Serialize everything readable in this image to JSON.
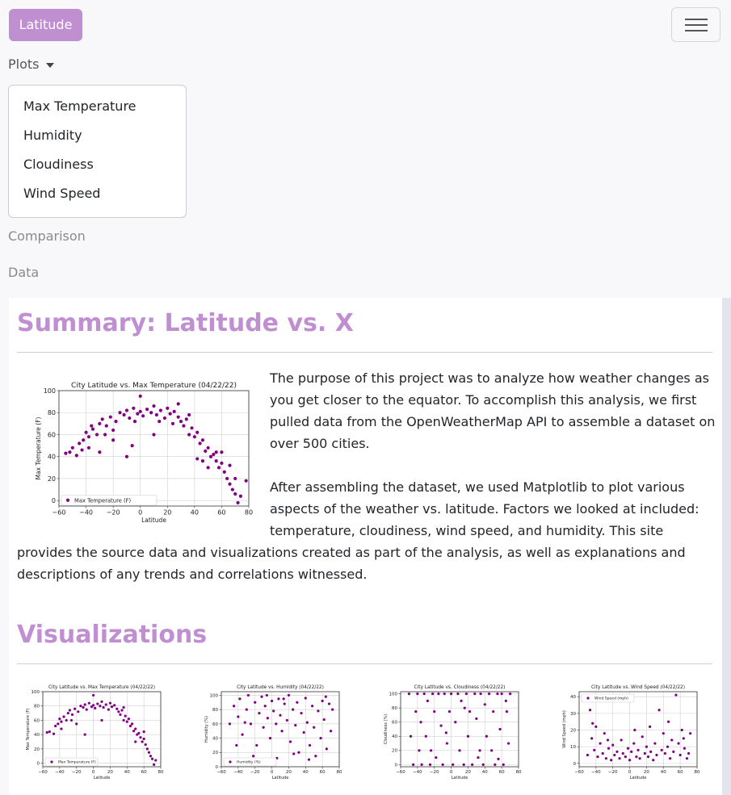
{
  "navbar": {
    "brand": "Latitude",
    "toggler_icon": "hamburger-icon",
    "plots_label": "Plots",
    "plots_menu": [
      "Max Temperature",
      "Humidity",
      "Cloudiness",
      "Wind Speed"
    ],
    "comparison_label": "Comparison",
    "data_label": "Data"
  },
  "colors": {
    "accent": "#c08fd1",
    "marker": "#800080"
  },
  "summary": {
    "heading": "Summary: Latitude vs. X",
    "para1_lines": [
      "The purpose of this project was to analyze how weather changes as",
      "you get closer to the equator. To accomplish this analysis, we first",
      "pulled data from the OpenWeatherMap API to assemble a dataset on",
      "over 500 cities."
    ],
    "para2_lines": [
      "After assembling the dataset, we used Matplotlib to plot various",
      "aspects of the weather vs. latitude. Factors we looked at included:",
      "temperature, cloudiness, wind speed, and humidity. This site",
      "provides the source data and visualizations created as part of the analysis, as well as explanations and",
      "descriptions of any trends and correlations witnessed."
    ]
  },
  "visualizations": {
    "heading": "Visualizations"
  },
  "chart_data": [
    {
      "id": "summary-temp",
      "type": "scatter",
      "title": "City Latitude vs. Max Temperature (04/22/22)",
      "xlabel": "Latitude",
      "ylabel": "Max Temperature (F)",
      "legend": "Max Temperature (F)",
      "xlim": [
        -60,
        80
      ],
      "ylim": [
        -5,
        100
      ],
      "xticks": [
        -60,
        -40,
        -20,
        0,
        20,
        40,
        60,
        80
      ],
      "yticks": [
        0,
        20,
        40,
        60,
        80,
        100
      ],
      "points": [
        [
          -55,
          43
        ],
        [
          -52,
          44
        ],
        [
          -47,
          41
        ],
        [
          -45,
          52
        ],
        [
          -42,
          55
        ],
        [
          -40,
          62
        ],
        [
          -38,
          58
        ],
        [
          -35,
          65
        ],
        [
          -32,
          60
        ],
        [
          -30,
          70
        ],
        [
          -28,
          74
        ],
        [
          -25,
          68
        ],
        [
          -22,
          76
        ],
        [
          -20,
          55
        ],
        [
          -18,
          72
        ],
        [
          -15,
          80
        ],
        [
          -12,
          78
        ],
        [
          -10,
          82
        ],
        [
          -8,
          75
        ],
        [
          -5,
          84
        ],
        [
          -2,
          79
        ],
        [
          0,
          81
        ],
        [
          2,
          77
        ],
        [
          5,
          83
        ],
        [
          8,
          80
        ],
        [
          10,
          86
        ],
        [
          12,
          78
        ],
        [
          15,
          82
        ],
        [
          18,
          75
        ],
        [
          20,
          84
        ],
        [
          22,
          79
        ],
        [
          25,
          81
        ],
        [
          28,
          76
        ],
        [
          30,
          72
        ],
        [
          32,
          68
        ],
        [
          34,
          74
        ],
        [
          36,
          60
        ],
        [
          38,
          66
        ],
        [
          40,
          58
        ],
        [
          42,
          62
        ],
        [
          44,
          52
        ],
        [
          46,
          55
        ],
        [
          48,
          45
        ],
        [
          50,
          48
        ],
        [
          52,
          40
        ],
        [
          54,
          42
        ],
        [
          56,
          36
        ],
        [
          58,
          30
        ],
        [
          60,
          34
        ],
        [
          62,
          26
        ],
        [
          64,
          20
        ],
        [
          66,
          15
        ],
        [
          68,
          10
        ],
        [
          70,
          6
        ],
        [
          72,
          -2
        ],
        [
          -38,
          48
        ],
        [
          -30,
          44
        ],
        [
          -10,
          40
        ],
        [
          -6,
          50
        ],
        [
          10,
          60
        ],
        [
          42,
          38
        ],
        [
          50,
          30
        ],
        [
          -50,
          48
        ],
        [
          -43,
          46
        ],
        [
          -36,
          68
        ],
        [
          -20,
          64
        ],
        [
          0,
          95
        ],
        [
          28,
          88
        ],
        [
          60,
          44
        ],
        [
          66,
          32
        ],
        [
          74,
          4
        ],
        [
          78,
          18
        ],
        [
          70,
          20
        ],
        [
          56,
          44
        ],
        [
          46,
          36
        ],
        [
          36,
          78
        ],
        [
          24,
          70
        ],
        [
          14,
          72
        ],
        [
          -4,
          72
        ],
        [
          -26,
          60
        ]
      ]
    },
    {
      "id": "viz-temp",
      "type": "scatter",
      "title": "City Latitude vs. Max Temperature (04/22/22)",
      "xlabel": "Latitude",
      "ylabel": "Max Temperature (F)",
      "legend": "Max Temperature (F)",
      "xlim": [
        -60,
        80
      ],
      "ylim": [
        -5,
        100
      ],
      "xticks": [
        -60,
        -40,
        -20,
        0,
        20,
        40,
        60,
        80
      ],
      "yticks": [
        0,
        20,
        40,
        60,
        80,
        100
      ],
      "points": [
        [
          -55,
          43
        ],
        [
          -52,
          44
        ],
        [
          -47,
          41
        ],
        [
          -45,
          52
        ],
        [
          -42,
          55
        ],
        [
          -40,
          62
        ],
        [
          -38,
          58
        ],
        [
          -35,
          65
        ],
        [
          -32,
          60
        ],
        [
          -30,
          70
        ],
        [
          -28,
          74
        ],
        [
          -25,
          68
        ],
        [
          -22,
          76
        ],
        [
          -20,
          55
        ],
        [
          -18,
          72
        ],
        [
          -15,
          80
        ],
        [
          -12,
          78
        ],
        [
          -10,
          82
        ],
        [
          -8,
          75
        ],
        [
          -5,
          84
        ],
        [
          -2,
          79
        ],
        [
          0,
          81
        ],
        [
          2,
          77
        ],
        [
          5,
          83
        ],
        [
          8,
          80
        ],
        [
          10,
          86
        ],
        [
          12,
          78
        ],
        [
          15,
          82
        ],
        [
          18,
          75
        ],
        [
          20,
          84
        ],
        [
          22,
          79
        ],
        [
          25,
          81
        ],
        [
          28,
          76
        ],
        [
          30,
          72
        ],
        [
          32,
          68
        ],
        [
          34,
          74
        ],
        [
          36,
          60
        ],
        [
          38,
          66
        ],
        [
          40,
          58
        ],
        [
          42,
          62
        ],
        [
          44,
          52
        ],
        [
          46,
          55
        ],
        [
          48,
          45
        ],
        [
          50,
          48
        ],
        [
          52,
          40
        ],
        [
          54,
          42
        ],
        [
          56,
          36
        ],
        [
          58,
          30
        ],
        [
          60,
          34
        ],
        [
          62,
          26
        ],
        [
          64,
          20
        ],
        [
          66,
          15
        ],
        [
          68,
          10
        ],
        [
          70,
          6
        ],
        [
          72,
          -2
        ],
        [
          -38,
          48
        ],
        [
          -10,
          40
        ],
        [
          10,
          60
        ],
        [
          50,
          30
        ],
        [
          0,
          95
        ],
        [
          60,
          44
        ],
        [
          74,
          4
        ],
        [
          36,
          78
        ],
        [
          -26,
          60
        ]
      ]
    },
    {
      "id": "viz-humidity",
      "type": "scatter",
      "title": "City Latitude vs. Humidity (04/22/22)",
      "xlabel": "Latitude",
      "ylabel": "Humidity (%)",
      "legend": "Humidity (%)",
      "xlim": [
        -60,
        80
      ],
      "ylim": [
        0,
        105
      ],
      "xticks": [
        -60,
        -40,
        -20,
        0,
        20,
        40,
        60,
        80
      ],
      "yticks": [
        0,
        20,
        40,
        60,
        80,
        100
      ],
      "points": [
        [
          -50,
          60
        ],
        [
          -45,
          85
        ],
        [
          -40,
          70
        ],
        [
          -38,
          95
        ],
        [
          -35,
          45
        ],
        [
          -30,
          80
        ],
        [
          -28,
          100
        ],
        [
          -25,
          60
        ],
        [
          -20,
          90
        ],
        [
          -18,
          30
        ],
        [
          -15,
          75
        ],
        [
          -12,
          98
        ],
        [
          -10,
          55
        ],
        [
          -8,
          85
        ],
        [
          -5,
          68
        ],
        [
          -2,
          40
        ],
        [
          0,
          92
        ],
        [
          2,
          78
        ],
        [
          5,
          60
        ],
        [
          8,
          95
        ],
        [
          10,
          72
        ],
        [
          12,
          50
        ],
        [
          15,
          88
        ],
        [
          18,
          65
        ],
        [
          20,
          100
        ],
        [
          22,
          35
        ],
        [
          25,
          80
        ],
        [
          28,
          58
        ],
        [
          30,
          90
        ],
        [
          32,
          20
        ],
        [
          35,
          75
        ],
        [
          38,
          48
        ],
        [
          40,
          96
        ],
        [
          42,
          62
        ],
        [
          45,
          30
        ],
        [
          48,
          85
        ],
        [
          50,
          55
        ],
        [
          52,
          15
        ],
        [
          55,
          78
        ],
        [
          58,
          40
        ],
        [
          60,
          92
        ],
        [
          62,
          66
        ],
        [
          65,
          25
        ],
        [
          68,
          88
        ],
        [
          70,
          50
        ],
        [
          -42,
          30
        ],
        [
          -22,
          15
        ],
        [
          6,
          12
        ],
        [
          26,
          18
        ],
        [
          44,
          10
        ],
        [
          64,
          98
        ],
        [
          72,
          80
        ],
        [
          -32,
          62
        ],
        [
          -6,
          100
        ],
        [
          14,
          95
        ]
      ]
    },
    {
      "id": "viz-cloudiness",
      "type": "scatter",
      "title": "City Latitude vs. Cloudiness (04/22/22)",
      "xlabel": "Latitude",
      "ylabel": "Cloudiness (%)",
      "legend": "",
      "xlim": [
        -60,
        80
      ],
      "ylim": [
        -3,
        103
      ],
      "xticks": [
        -60,
        -40,
        -20,
        0,
        20,
        40,
        60,
        80
      ],
      "yticks": [
        0,
        20,
        40,
        60,
        80,
        100
      ],
      "points": [
        [
          -50,
          100
        ],
        [
          -45,
          0
        ],
        [
          -42,
          75
        ],
        [
          -40,
          100
        ],
        [
          -38,
          20
        ],
        [
          -35,
          0
        ],
        [
          -32,
          100
        ],
        [
          -30,
          40
        ],
        [
          -28,
          90
        ],
        [
          -25,
          0
        ],
        [
          -22,
          100
        ],
        [
          -20,
          75
        ],
        [
          -18,
          10
        ],
        [
          -15,
          100
        ],
        [
          -12,
          55
        ],
        [
          -10,
          0
        ],
        [
          -8,
          100
        ],
        [
          -5,
          30
        ],
        [
          -2,
          75
        ],
        [
          0,
          100
        ],
        [
          2,
          0
        ],
        [
          5,
          60
        ],
        [
          8,
          100
        ],
        [
          10,
          20
        ],
        [
          12,
          90
        ],
        [
          15,
          0
        ],
        [
          18,
          100
        ],
        [
          20,
          40
        ],
        [
          22,
          75
        ],
        [
          25,
          0
        ],
        [
          28,
          100
        ],
        [
          30,
          65
        ],
        [
          32,
          10
        ],
        [
          35,
          100
        ],
        [
          38,
          0
        ],
        [
          40,
          85
        ],
        [
          42,
          40
        ],
        [
          45,
          100
        ],
        [
          48,
          20
        ],
        [
          50,
          75
        ],
        [
          52,
          0
        ],
        [
          55,
          100
        ],
        [
          58,
          50
        ],
        [
          60,
          100
        ],
        [
          62,
          0
        ],
        [
          65,
          90
        ],
        [
          68,
          30
        ],
        [
          70,
          100
        ],
        [
          -48,
          40
        ],
        [
          -36,
          60
        ],
        [
          -6,
          45
        ],
        [
          16,
          80
        ],
        [
          34,
          20
        ],
        [
          56,
          8
        ],
        [
          66,
          75
        ],
        [
          -24,
          20
        ]
      ]
    },
    {
      "id": "viz-wind",
      "type": "scatter",
      "title": "City Latitude vs. Wind Speed (04/22/22)",
      "xlabel": "Latitude",
      "ylabel": "Wind Speed (mph)",
      "legend": "Wind Speed (mph)",
      "xlim": [
        -60,
        80
      ],
      "ylim": [
        -2,
        43
      ],
      "xticks": [
        -60,
        -40,
        -20,
        0,
        20,
        40,
        60,
        80
      ],
      "yticks": [
        0,
        10,
        20,
        30,
        40
      ],
      "points": [
        [
          -50,
          5
        ],
        [
          -47,
          32
        ],
        [
          -45,
          15
        ],
        [
          -42,
          8
        ],
        [
          -40,
          22
        ],
        [
          -38,
          4
        ],
        [
          -35,
          12
        ],
        [
          -32,
          6
        ],
        [
          -30,
          18
        ],
        [
          -28,
          3
        ],
        [
          -25,
          9
        ],
        [
          -22,
          2
        ],
        [
          -20,
          11
        ],
        [
          -18,
          5
        ],
        [
          -15,
          7
        ],
        [
          -12,
          3
        ],
        [
          -10,
          14
        ],
        [
          -8,
          6
        ],
        [
          -5,
          4
        ],
        [
          -2,
          9
        ],
        [
          0,
          2
        ],
        [
          2,
          7
        ],
        [
          5,
          12
        ],
        [
          8,
          4
        ],
        [
          10,
          8
        ],
        [
          12,
          3
        ],
        [
          15,
          16
        ],
        [
          18,
          6
        ],
        [
          20,
          10
        ],
        [
          22,
          4
        ],
        [
          25,
          7
        ],
        [
          28,
          2
        ],
        [
          30,
          12
        ],
        [
          32,
          5
        ],
        [
          35,
          32
        ],
        [
          38,
          8
        ],
        [
          40,
          18
        ],
        [
          42,
          6
        ],
        [
          45,
          10
        ],
        [
          48,
          3
        ],
        [
          50,
          14
        ],
        [
          52,
          7
        ],
        [
          55,
          41
        ],
        [
          58,
          12
        ],
        [
          60,
          5
        ],
        [
          62,
          20
        ],
        [
          65,
          9
        ],
        [
          68,
          3
        ],
        [
          70,
          6
        ],
        [
          -44,
          24
        ],
        [
          -26,
          14
        ],
        [
          6,
          20
        ],
        [
          24,
          22
        ],
        [
          46,
          25
        ],
        [
          64,
          15
        ],
        [
          72,
          18
        ]
      ]
    }
  ]
}
